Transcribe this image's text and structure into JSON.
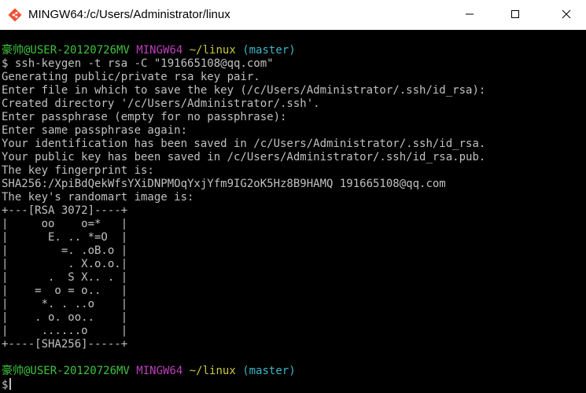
{
  "window": {
    "title": "MINGW64:/c/Users/Administrator/linux",
    "app_icon": "git-bash-icon",
    "controls": [
      "minimize-icon",
      "maximize-icon",
      "close-icon"
    ]
  },
  "prompt": {
    "user_host": "豪帅@USER-20120726MV",
    "system": "MINGW64",
    "path": "~/linux",
    "branch": "(master)",
    "symbol": "$"
  },
  "command": "ssh-keygen -t rsa -C \"191665108@qq.com\"",
  "output_lines": [
    "Generating public/private rsa key pair.",
    "Enter file in which to save the key (/c/Users/Administrator/.ssh/id_rsa):",
    "Created directory '/c/Users/Administrator/.ssh'.",
    "Enter passphrase (empty for no passphrase):",
    "Enter same passphrase again:",
    "Your identification has been saved in /c/Users/Administrator/.ssh/id_rsa.",
    "Your public key has been saved in /c/Users/Administrator/.ssh/id_rsa.pub.",
    "The key fingerprint is:",
    "SHA256:/XpiBdQekWfsYXiDNPMOqYxjYfm9IG2oK5Hz8B9HAMQ 191665108@qq.com",
    "The key's randomart image is:",
    "+---[RSA 3072]----+",
    "|     oo    o=*   |",
    "|      E. .. *=O  |",
    "|        =. .oB.o |",
    "|         . X.o.o.|",
    "|      .  S X.. . |",
    "|    =  o = o..   |",
    "|     *. . ..o    |",
    "|    . o. oo..    |",
    "|     ......o     |",
    "+----[SHA256]-----+"
  ],
  "colors": {
    "background": "#000000",
    "text": "#c0c0c0",
    "user_host": "#3fc23f",
    "system": "#bc3fbc",
    "path": "#c8c83f",
    "branch": "#3fb4c8"
  }
}
